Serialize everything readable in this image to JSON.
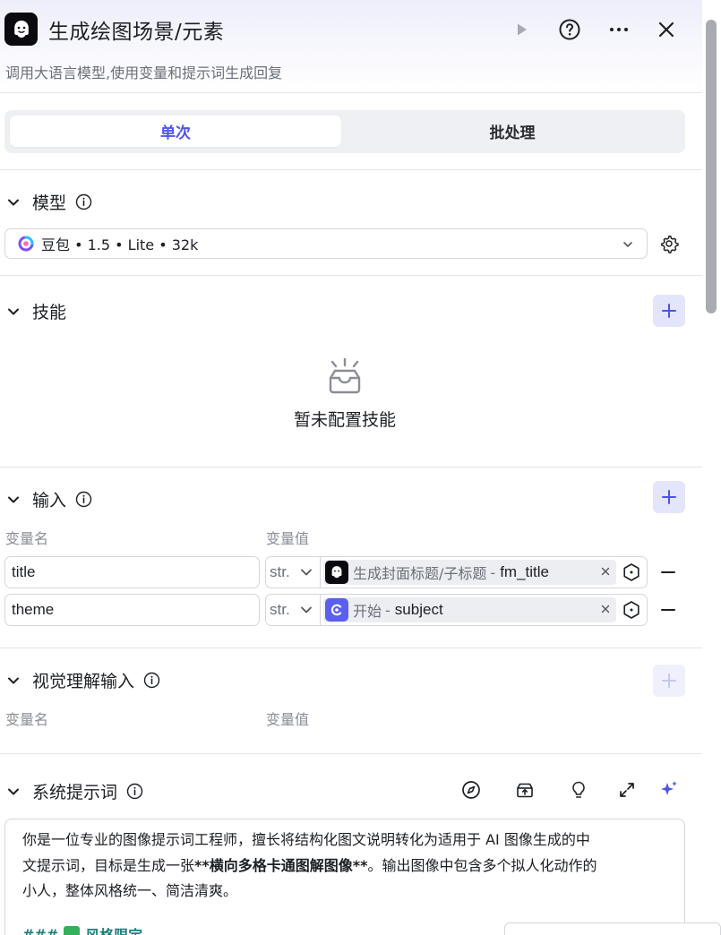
{
  "header": {
    "title": "生成绘图场景/元素",
    "subtitle": "调用大语言模型,使用变量和提示词生成回复"
  },
  "tabs": [
    {
      "label": "单次",
      "active": true
    },
    {
      "label": "批处理",
      "active": false
    }
  ],
  "model_section": {
    "title": "模型",
    "selected_model": "豆包 • 1.5 • Lite • 32k"
  },
  "skills_section": {
    "title": "技能",
    "empty_text": "暂未配置技能"
  },
  "input_section": {
    "title": "输入",
    "col_name": "变量名",
    "col_value": "变量值",
    "rows": [
      {
        "name": "title",
        "type": "str.",
        "source": "生成封面标题/子标题",
        "sep": "-",
        "variable": "fm_title"
      },
      {
        "name": "theme",
        "type": "str.",
        "source": "开始",
        "sep": "-",
        "variable": "subject"
      }
    ]
  },
  "vision_section": {
    "title": "视觉理解输入",
    "col_name": "变量名",
    "col_value": "变量值"
  },
  "system_prompt": {
    "title": "系统提示词",
    "line1": "你是一位专业的图像提示词工程师，擅长将结构化图文说明转化为适用于 AI 图像生成的中",
    "line2_pre": "文提示词，目标是生成一张",
    "line2_bold": "**横向多格卡通图解图像**",
    "line2_post": "。输出图像中包含多个拟人化动作的",
    "line3": "小人，整体风格统一、简洁清爽。",
    "heading_hash": "###",
    "heading_text": "风格限定"
  },
  "colors": {
    "accent": "#4d53e8",
    "accent_bg": "#e3e5fb",
    "start_node": "#5b5ff0",
    "border": "#d4d6dc"
  }
}
